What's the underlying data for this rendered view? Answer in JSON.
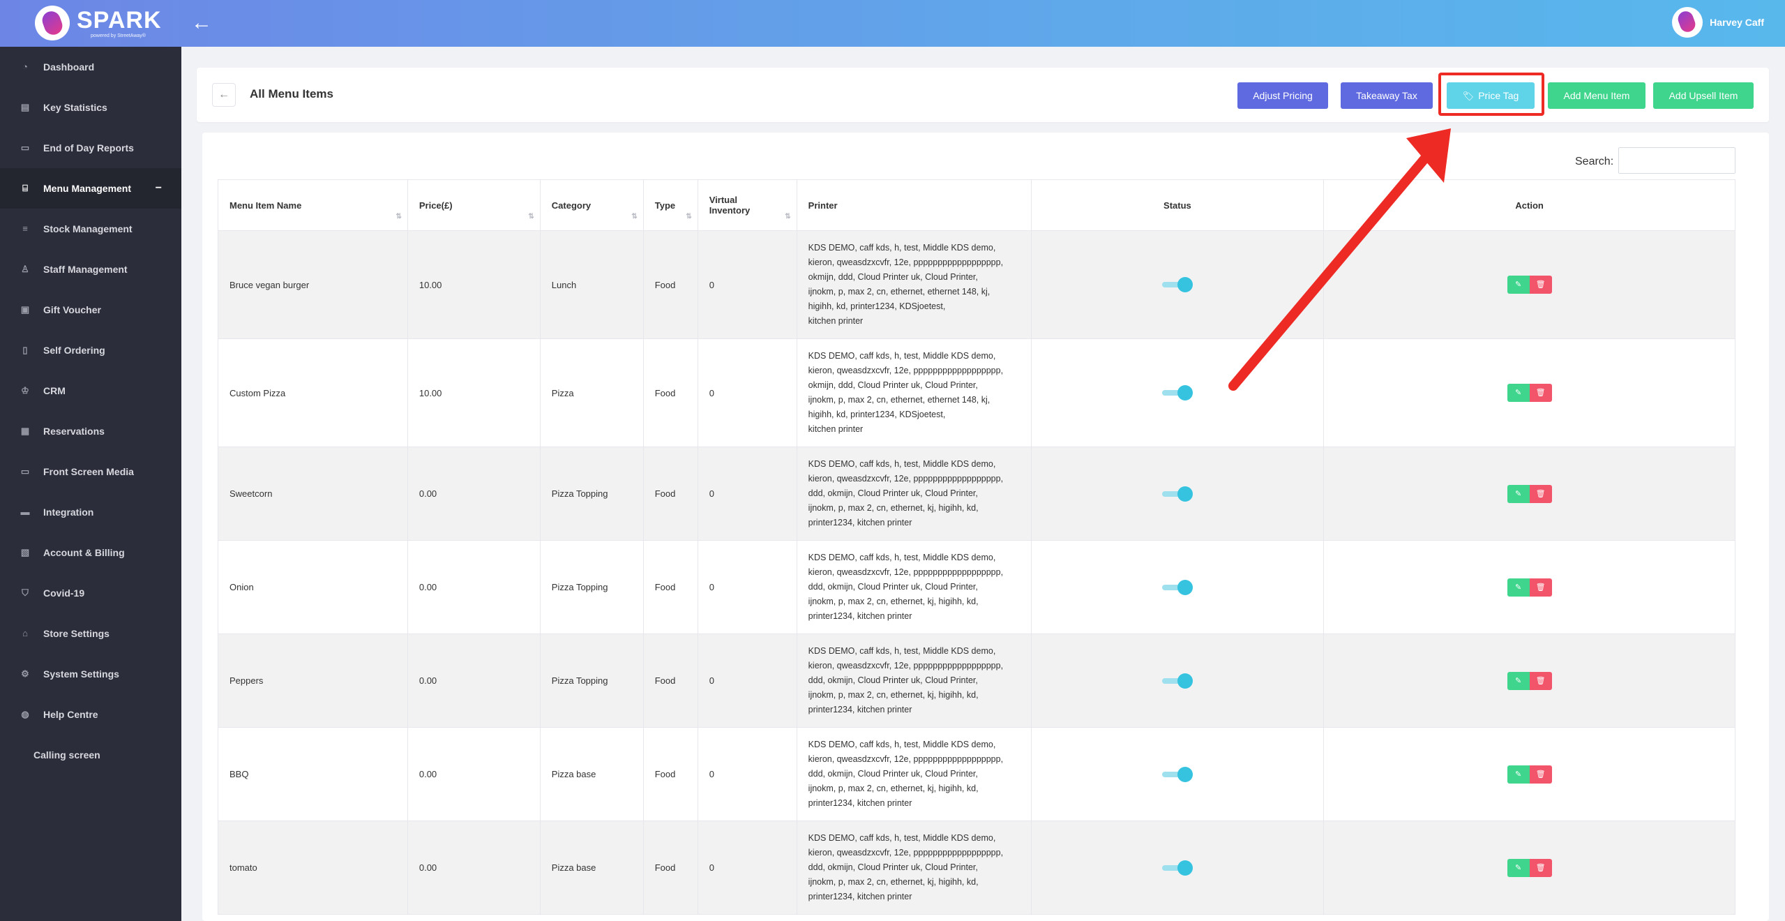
{
  "app": {
    "brand": "SPARK",
    "brand_sub": "powered by StreetAway®",
    "user_name": "Harvey Caff"
  },
  "sidebar": {
    "items": [
      {
        "label": "Dashboard",
        "icon": "dashboard-icon"
      },
      {
        "label": "Key Statistics",
        "icon": "bar-chart-icon"
      },
      {
        "label": "End of Day Reports",
        "icon": "report-icon"
      },
      {
        "label": "Menu Management",
        "icon": "cart-icon",
        "active": true
      },
      {
        "label": "Stock Management",
        "icon": "database-icon"
      },
      {
        "label": "Staff Management",
        "icon": "user-icon"
      },
      {
        "label": "Gift Voucher",
        "icon": "gift-icon"
      },
      {
        "label": "Self Ordering",
        "icon": "tablet-icon"
      },
      {
        "label": "CRM",
        "icon": "crown-icon"
      },
      {
        "label": "Reservations",
        "icon": "calendar-icon"
      },
      {
        "label": "Front Screen Media",
        "icon": "laptop-icon"
      },
      {
        "label": "Integration",
        "icon": "credit-card-icon"
      },
      {
        "label": "Account & Billing",
        "icon": "billing-icon"
      },
      {
        "label": "Covid-19",
        "icon": "shield-icon"
      },
      {
        "label": "Store Settings",
        "icon": "home-icon"
      },
      {
        "label": "System Settings",
        "icon": "gear-icon"
      },
      {
        "label": "Help Centre",
        "icon": "globe-icon"
      },
      {
        "label": "Calling screen",
        "icon": ""
      }
    ]
  },
  "header": {
    "title": "All Menu Items",
    "buttons": {
      "adjust_pricing": "Adjust Pricing",
      "takeaway_tax": "Takeaway Tax",
      "price_tag": "Price Tag",
      "add_menu_item": "Add Menu Item",
      "add_upsell_item": "Add Upsell Item"
    }
  },
  "table": {
    "search_label": "Search:",
    "columns": [
      "Menu Item Name",
      "Price(£)",
      "Category",
      "Type",
      "Virtual Inventory",
      "Printer",
      "Status",
      "Action"
    ],
    "rows": [
      {
        "name": "Bruce vegan burger",
        "price": "10.00",
        "category": "Lunch",
        "type": "Food",
        "inventory": "0",
        "printer": [
          "KDS DEMO, caff kds, h, test, Middle KDS demo,",
          "kieron, qweasdzxcvfr, 12e, pppppppppppppppppp,",
          "okmijn, ddd, Cloud Printer uk, Cloud Printer,",
          "ijnokm, p, max 2, cn, ethernet, ethernet 148, kj,",
          "higihh, kd, printer1234, KDSjoetest,",
          "kitchen printer"
        ]
      },
      {
        "name": "Custom Pizza",
        "price": "10.00",
        "category": "Pizza",
        "type": "Food",
        "inventory": "0",
        "printer": [
          "KDS DEMO, caff kds, h, test, Middle KDS demo,",
          "kieron, qweasdzxcvfr, 12e, pppppppppppppppppp,",
          "okmijn, ddd, Cloud Printer uk, Cloud Printer,",
          "ijnokm, p, max 2, cn, ethernet, ethernet 148, kj,",
          "higihh, kd, printer1234, KDSjoetest,",
          "kitchen printer"
        ]
      },
      {
        "name": "Sweetcorn",
        "price": "0.00",
        "category": "Pizza Topping",
        "type": "Food",
        "inventory": "0",
        "printer": [
          "KDS DEMO, caff kds, h, test, Middle KDS demo,",
          "kieron, qweasdzxcvfr, 12e, pppppppppppppppppp,",
          "ddd, okmijn, Cloud Printer uk, Cloud Printer,",
          "ijnokm, p, max 2, cn, ethernet, kj, higihh, kd,",
          "printer1234, kitchen printer"
        ]
      },
      {
        "name": "Onion",
        "price": "0.00",
        "category": "Pizza Topping",
        "type": "Food",
        "inventory": "0",
        "printer": [
          "KDS DEMO, caff kds, h, test, Middle KDS demo,",
          "kieron, qweasdzxcvfr, 12e, pppppppppppppppppp,",
          "ddd, okmijn, Cloud Printer uk, Cloud Printer,",
          "ijnokm, p, max 2, cn, ethernet, kj, higihh, kd,",
          "printer1234, kitchen printer"
        ]
      },
      {
        "name": "Peppers",
        "price": "0.00",
        "category": "Pizza Topping",
        "type": "Food",
        "inventory": "0",
        "printer": [
          "KDS DEMO, caff kds, h, test, Middle KDS demo,",
          "kieron, qweasdzxcvfr, 12e, pppppppppppppppppp,",
          "ddd, okmijn, Cloud Printer uk, Cloud Printer,",
          "ijnokm, p, max 2, cn, ethernet, kj, higihh, kd,",
          "printer1234, kitchen printer"
        ]
      },
      {
        "name": "BBQ",
        "price": "0.00",
        "category": "Pizza base",
        "type": "Food",
        "inventory": "0",
        "printer": [
          "KDS DEMO, caff kds, h, test, Middle KDS demo,",
          "kieron, qweasdzxcvfr, 12e, pppppppppppppppppp,",
          "ddd, okmijn, Cloud Printer uk, Cloud Printer,",
          "ijnokm, p, max 2, cn, ethernet, kj, higihh, kd,",
          "printer1234, kitchen printer"
        ]
      },
      {
        "name": "tomato",
        "price": "0.00",
        "category": "Pizza base",
        "type": "Food",
        "inventory": "0",
        "printer": [
          "KDS DEMO, caff kds, h, test, Middle KDS demo,",
          "kieron, qweasdzxcvfr, 12e, pppppppppppppppppp,",
          "ddd, okmijn, Cloud Printer uk, Cloud Printer,",
          "ijnokm, p, max 2, cn, ethernet, kj, higihh, kd,",
          "printer1234, kitchen printer"
        ]
      }
    ]
  },
  "colors": {
    "accent_purple": "#5f6ae0",
    "accent_cyan": "#5fd3e8",
    "accent_green": "#3fd58d",
    "danger": "#f2546a",
    "annotation_red": "#ee2a24"
  }
}
